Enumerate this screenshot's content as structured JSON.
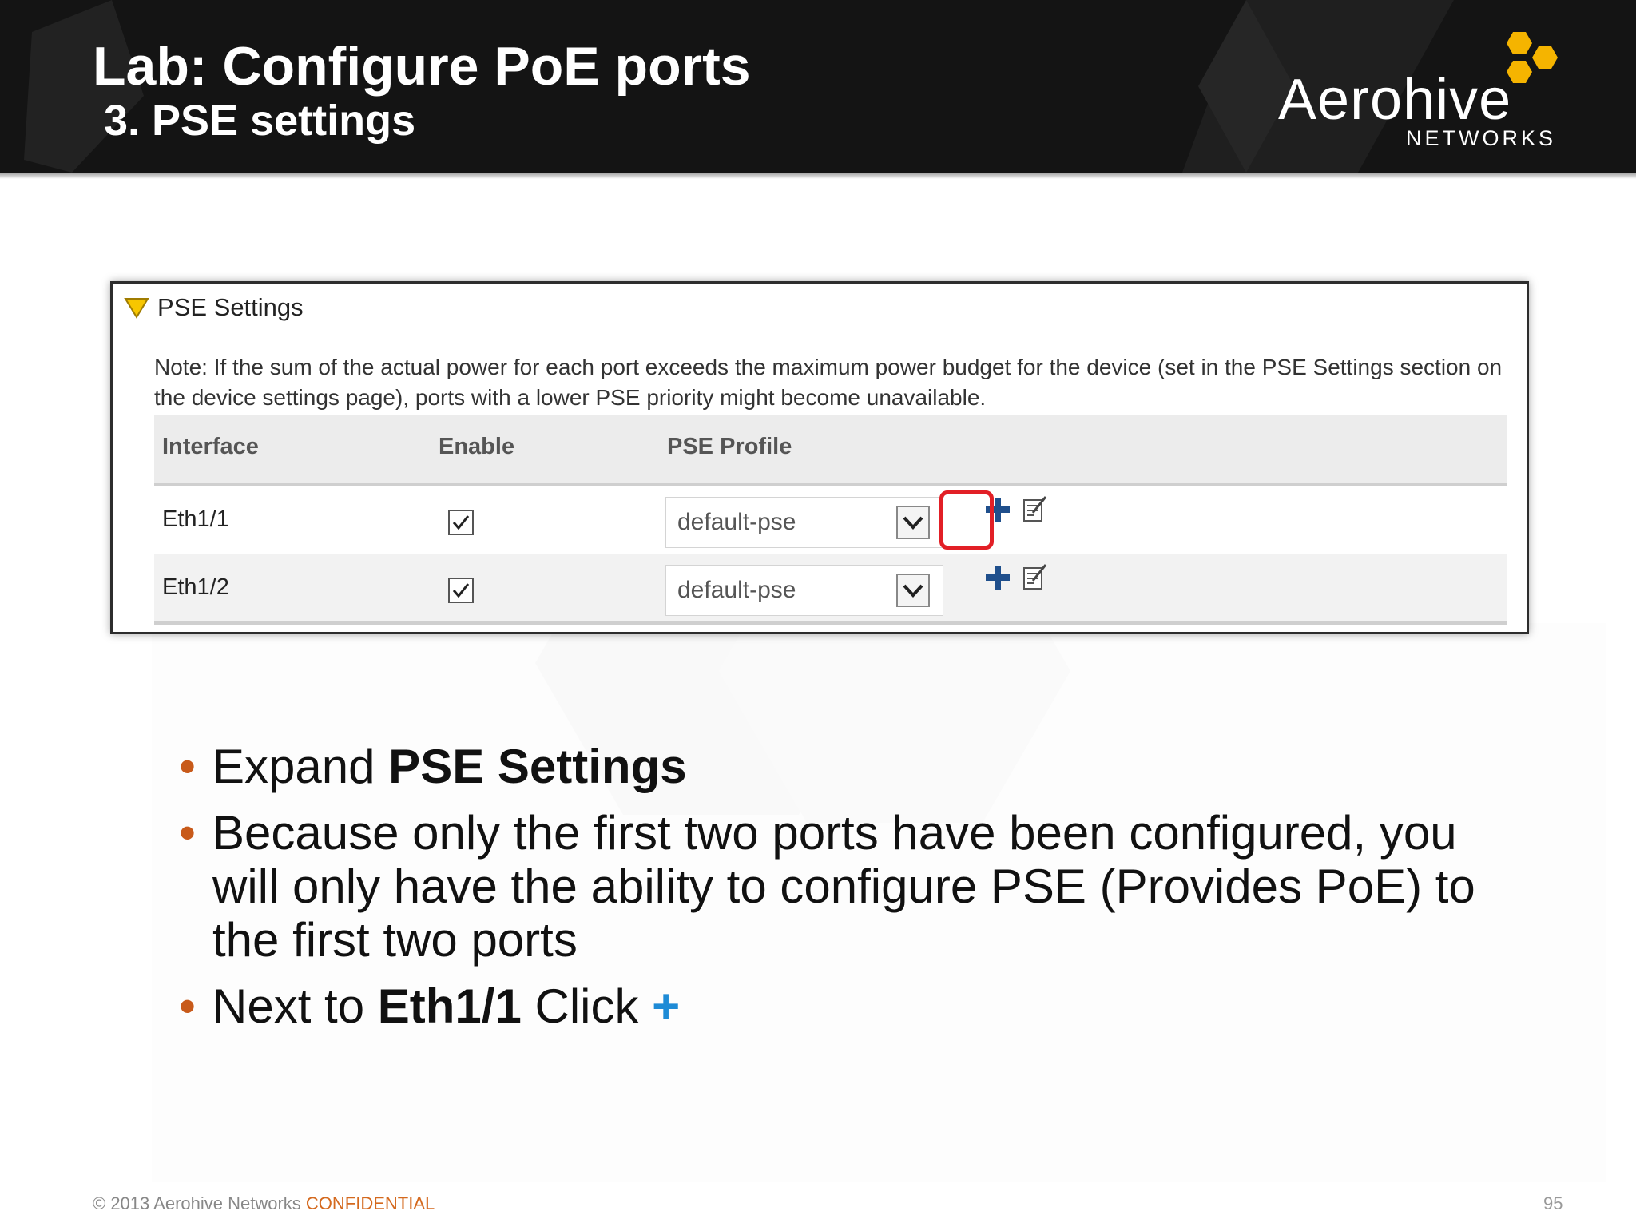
{
  "header": {
    "title": "Lab: Configure PoE ports",
    "subtitle": "3. PSE settings",
    "logo": {
      "name": "Aerohive",
      "tagline": "NETWORKS"
    }
  },
  "panel": {
    "title": "PSE Settings",
    "note": "Note: If the sum of the actual power for each port exceeds the maximum power budget for the device (set in the PSE Settings section on the device settings page), ports with a lower PSE priority might become unavailable.",
    "columns": [
      "Interface",
      "Enable",
      "PSE Profile"
    ],
    "rows": [
      {
        "interface": "Eth1/1",
        "enabled": true,
        "profile": "default-pse"
      },
      {
        "interface": "Eth1/2",
        "enabled": true,
        "profile": "default-pse"
      }
    ]
  },
  "bullets": {
    "b1_pre": "Expand ",
    "b1_bold": "PSE Settings",
    "b2": "Because only the first two ports have been configured, you will only have the ability to configure PSE (Provides PoE) to the first two ports",
    "b3_pre": "Next to ",
    "b3_bold": "Eth1/1",
    "b3_mid": " Click ",
    "b3_plus": "+"
  },
  "footer": {
    "copyright": "© 2013 Aerohive Networks ",
    "confidential": "CONFIDENTIAL",
    "page": "95"
  },
  "colors": {
    "header_bg": "#141414",
    "accent_orange": "#c85a1a",
    "plus_blue": "#1e8bd6",
    "highlight_red": "#e21f26",
    "logo_gold": "#f5b400"
  }
}
